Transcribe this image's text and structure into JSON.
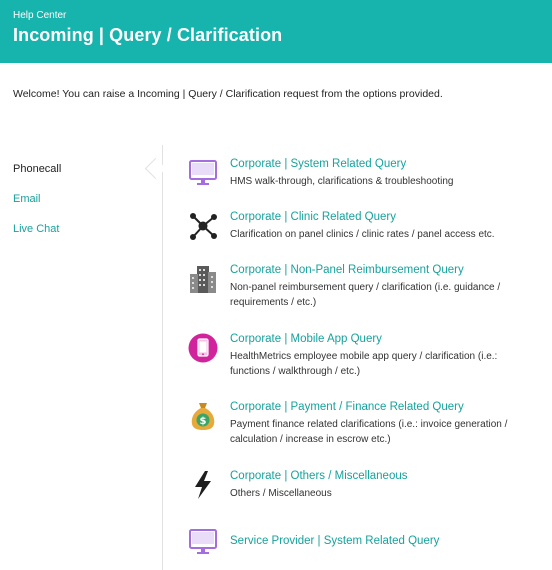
{
  "header": {
    "subtitle": "Help Center",
    "title": "Incoming | Query / Clarification"
  },
  "welcome_text": "Welcome! You can raise a Incoming | Query / Clarification request from the options provided.",
  "nav": {
    "items": [
      {
        "label": "Phonecall",
        "active": true
      },
      {
        "label": "Email",
        "active": false
      },
      {
        "label": "Live Chat",
        "active": false
      }
    ]
  },
  "options": [
    {
      "title": "Corporate | System Related Query",
      "desc": "HMS walk-through, clarifications & troubleshooting",
      "icon": "monitor-icon"
    },
    {
      "title": "Corporate | Clinic Related Query",
      "desc": "Clarification on panel clinics / clinic rates / panel access etc.",
      "icon": "network-icon"
    },
    {
      "title": "Corporate | Non-Panel Reimbursement Query",
      "desc": "Non-panel reimbursement query / clarification (i.e. guidance / requirements / etc.)",
      "icon": "building-icon"
    },
    {
      "title": "Corporate | Mobile App Query",
      "desc": "HealthMetrics employee mobile app query / clarification (i.e.: functions / walkthrough / etc.)",
      "icon": "mobile-icon"
    },
    {
      "title": "Corporate | Payment / Finance Related Query",
      "desc": "Payment finance related clarifications (i.e.: invoice generation / calculation / increase in escrow etc.)",
      "icon": "money-bag-icon"
    },
    {
      "title": "Corporate | Others / Miscellaneous",
      "desc": "Others / Miscellaneous",
      "icon": "lightning-icon"
    },
    {
      "title": "Service Provider | System Related Query",
      "desc": "",
      "icon": "monitor-icon"
    }
  ],
  "colors": {
    "header_bg": "#17b3ad",
    "link": "#17a29c",
    "monitor_purple": "#a46ee0",
    "mobile_magenta": "#d1239b",
    "money_gold": "#e6a93a"
  }
}
